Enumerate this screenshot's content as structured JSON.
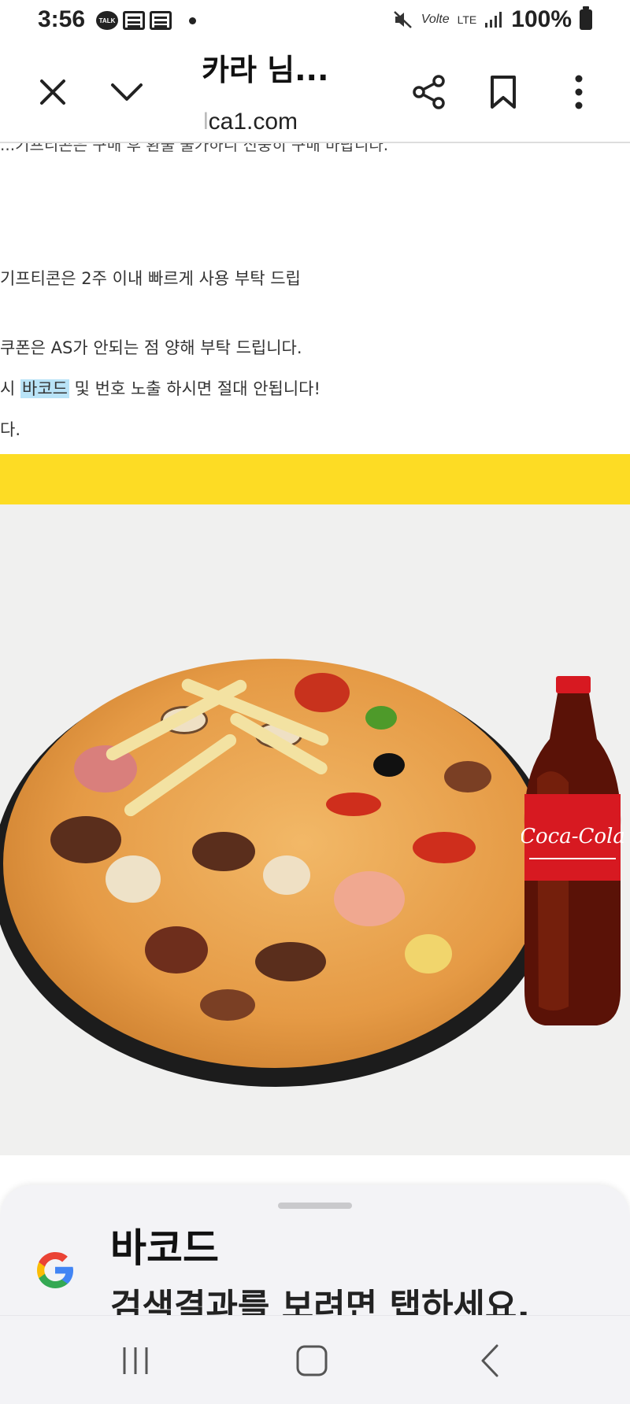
{
  "status_bar": {
    "time": "3:56",
    "talk_badge": "TALK",
    "volte": "Volte",
    "lte": "LTE",
    "battery_percent": "100%"
  },
  "browser": {
    "title": "카라 님...",
    "url_faded": "l",
    "url_main": "ca1.com"
  },
  "page": {
    "cut_line": "...기프티콘은 구매 후 환불 불가하니 신중히 구매 바랍니다.",
    "notice_lines": [
      {
        "before": "기프티콘은 2주 이내 빠르게 사용 부탁 드립",
        "highlight": "",
        "after": ""
      },
      {
        "before": "쿠폰은 AS가 안되는 점 양해 부탁 드립니다.",
        "highlight": "",
        "after": ""
      },
      {
        "before": "시 ",
        "highlight": "바코드",
        "after": " 및 번호 노출 하시면 절대 안됩니다!"
      },
      {
        "before": "다.",
        "highlight": "",
        "after": ""
      }
    ],
    "band_color": "#fddc24",
    "cola_brand": "Coca-Cola"
  },
  "search_sheet": {
    "term": "바코드",
    "hint": "검색결과를 보려면 탭하세요."
  },
  "colors": {
    "highlight": "#b9e3f7",
    "sheet_bg": "#f3f3f6"
  }
}
